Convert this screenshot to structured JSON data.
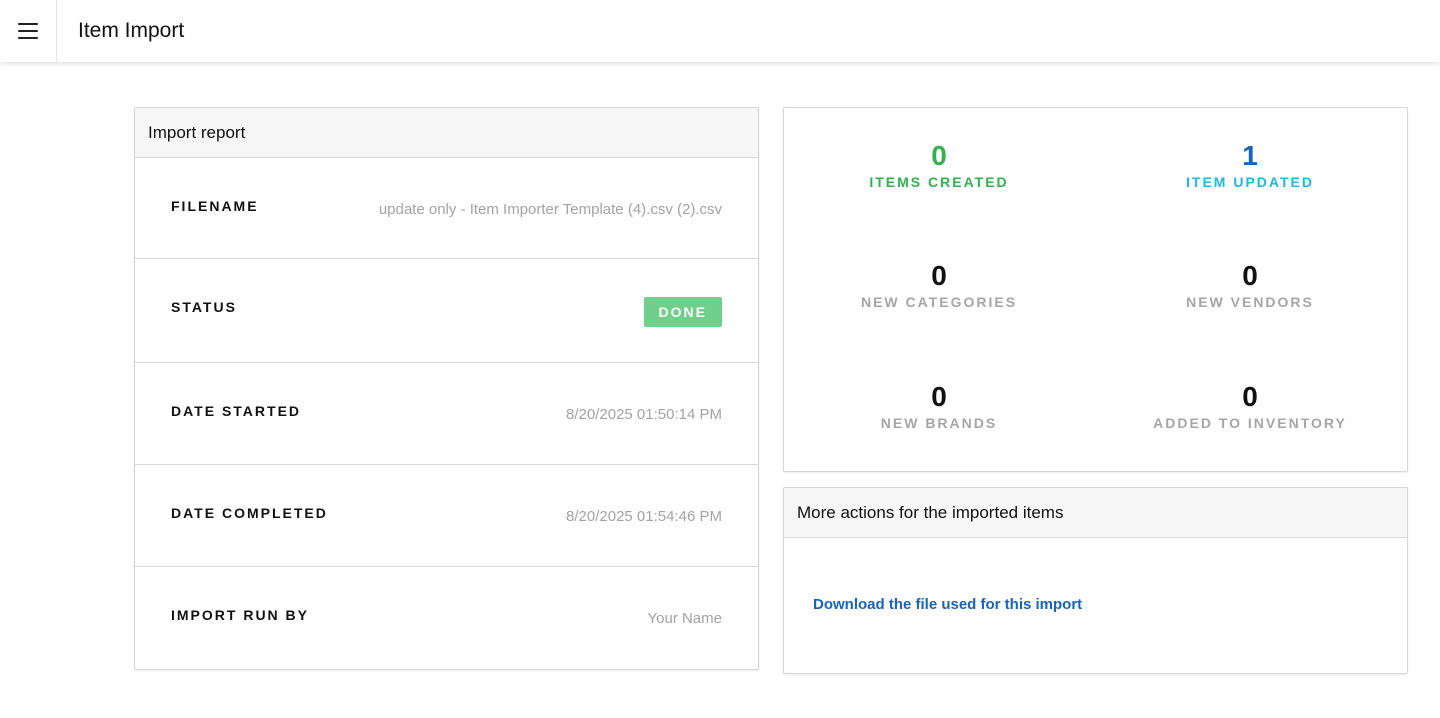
{
  "header": {
    "title": "Item Import",
    "menu_icon": "hamburger-menu-icon"
  },
  "report": {
    "title": "Import report",
    "rows": [
      {
        "label": "FILENAME",
        "value": "update only - Item Importer Template (4).csv (2).csv"
      },
      {
        "label": "STATUS",
        "value": "DONE"
      },
      {
        "label": "DATE STARTED",
        "value": "8/20/2025 01:50:14 PM"
      },
      {
        "label": "DATE COMPLETED",
        "value": "8/20/2025 01:54:46 PM"
      },
      {
        "label": "IMPORT RUN BY",
        "value": "Your Name"
      }
    ],
    "status_color": "#6fcf8b"
  },
  "stats": {
    "items_created": {
      "value": "0",
      "label": "ITEMS CREATED",
      "color": "#2fb34a"
    },
    "item_updated": {
      "value": "1",
      "label": "ITEM UPDATED",
      "num_color": "#1565c0",
      "label_color": "#1fb6e8"
    },
    "new_categories": {
      "value": "0",
      "label": "NEW CATEGORIES"
    },
    "new_vendors": {
      "value": "0",
      "label": "NEW VENDORS"
    },
    "new_brands": {
      "value": "0",
      "label": "NEW BRANDS"
    },
    "added_to_inventory": {
      "value": "0",
      "label": "ADDED TO INVENTORY"
    }
  },
  "actions": {
    "title": "More actions for the imported items",
    "download_link": "Download the file used for this import",
    "link_color": "#1565c0"
  }
}
